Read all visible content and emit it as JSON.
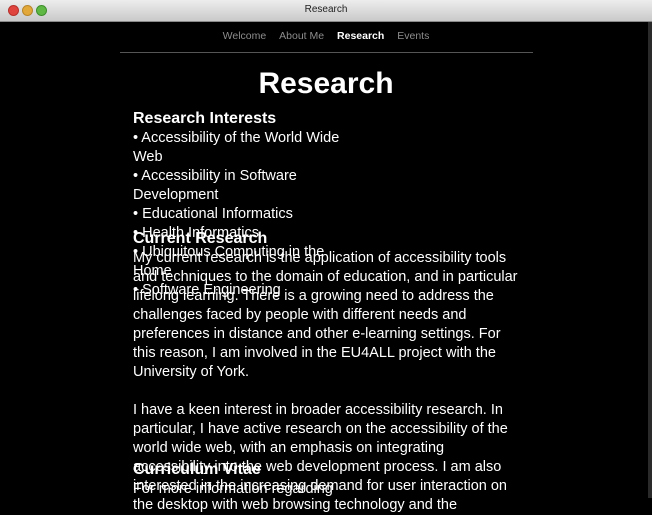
{
  "window": {
    "title": "Research"
  },
  "nav": [
    "Welcome",
    "About Me",
    "Research",
    "Events"
  ],
  "page_title": "Research",
  "research_interests": {
    "heading": "Research Interests",
    "items": [
      "• Accessibility of the World Wide Web",
      "• Accessibility in Software Development",
      "• Educational Informatics",
      "• Health Informatics",
      "• Ubiquitous Computing in the Home",
      "• Software Engineering"
    ]
  },
  "current_research": {
    "heading": "Current Research",
    "para1": "My current research is the application of accessibility tools and techniques to the domain of education, and in particular lifelong learning. There is a growing need to address the challenges faced by people with different needs and preferences in distance and other e-learning settings. For this reason, I am involved in the EU4ALL project with the University of York.",
    "para2": "I have a keen interest in broader accessibility research. In particular, I have active research on the accessibility of the world wide web, with an emphasis on integrating accessibility into the web development process. I am also interested in the increasing demand for user interaction on the desktop with web browsing technology and the"
  },
  "curriculum_vitae": {
    "heading": "Curriculum Vitae",
    "text": "For more information regarding"
  }
}
